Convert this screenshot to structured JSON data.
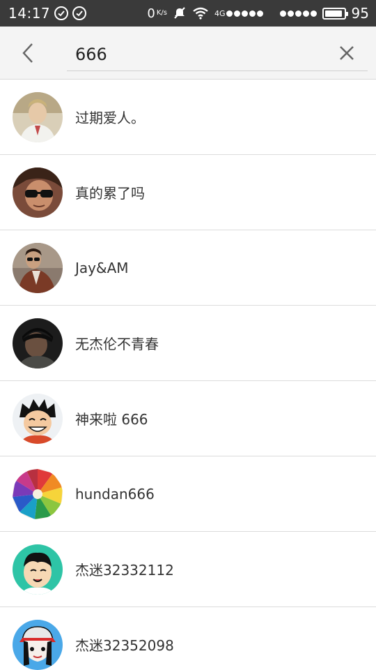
{
  "status_bar": {
    "time": "14:17",
    "net_speed": "0",
    "net_speed_unit": "K/s",
    "network_type": "4G",
    "battery_level": "95"
  },
  "search": {
    "query": "666"
  },
  "results": [
    {
      "name": "过期爱人。",
      "avatar": "portrait-white-jacket"
    },
    {
      "name": "真的累了吗",
      "avatar": "portrait-sunglasses"
    },
    {
      "name": "Jay&AM",
      "avatar": "portrait-sunglasses-jacket"
    },
    {
      "name": "无杰伦不青春",
      "avatar": "portrait-dark-cap"
    },
    {
      "name": "神来啦 666",
      "avatar": "cartoon-luffy"
    },
    {
      "name": "hundan666",
      "avatar": "colored-pencils"
    },
    {
      "name": "杰迷32332112",
      "avatar": "cartoon-boy-teal"
    },
    {
      "name": "杰迷32352098",
      "avatar": "cartoon-girl-cap"
    }
  ],
  "colors": {
    "status_bar_bg": "#3a3a3a",
    "header_bg": "#f4f4f4",
    "divider": "#dcdcdc",
    "text": "#333333"
  }
}
